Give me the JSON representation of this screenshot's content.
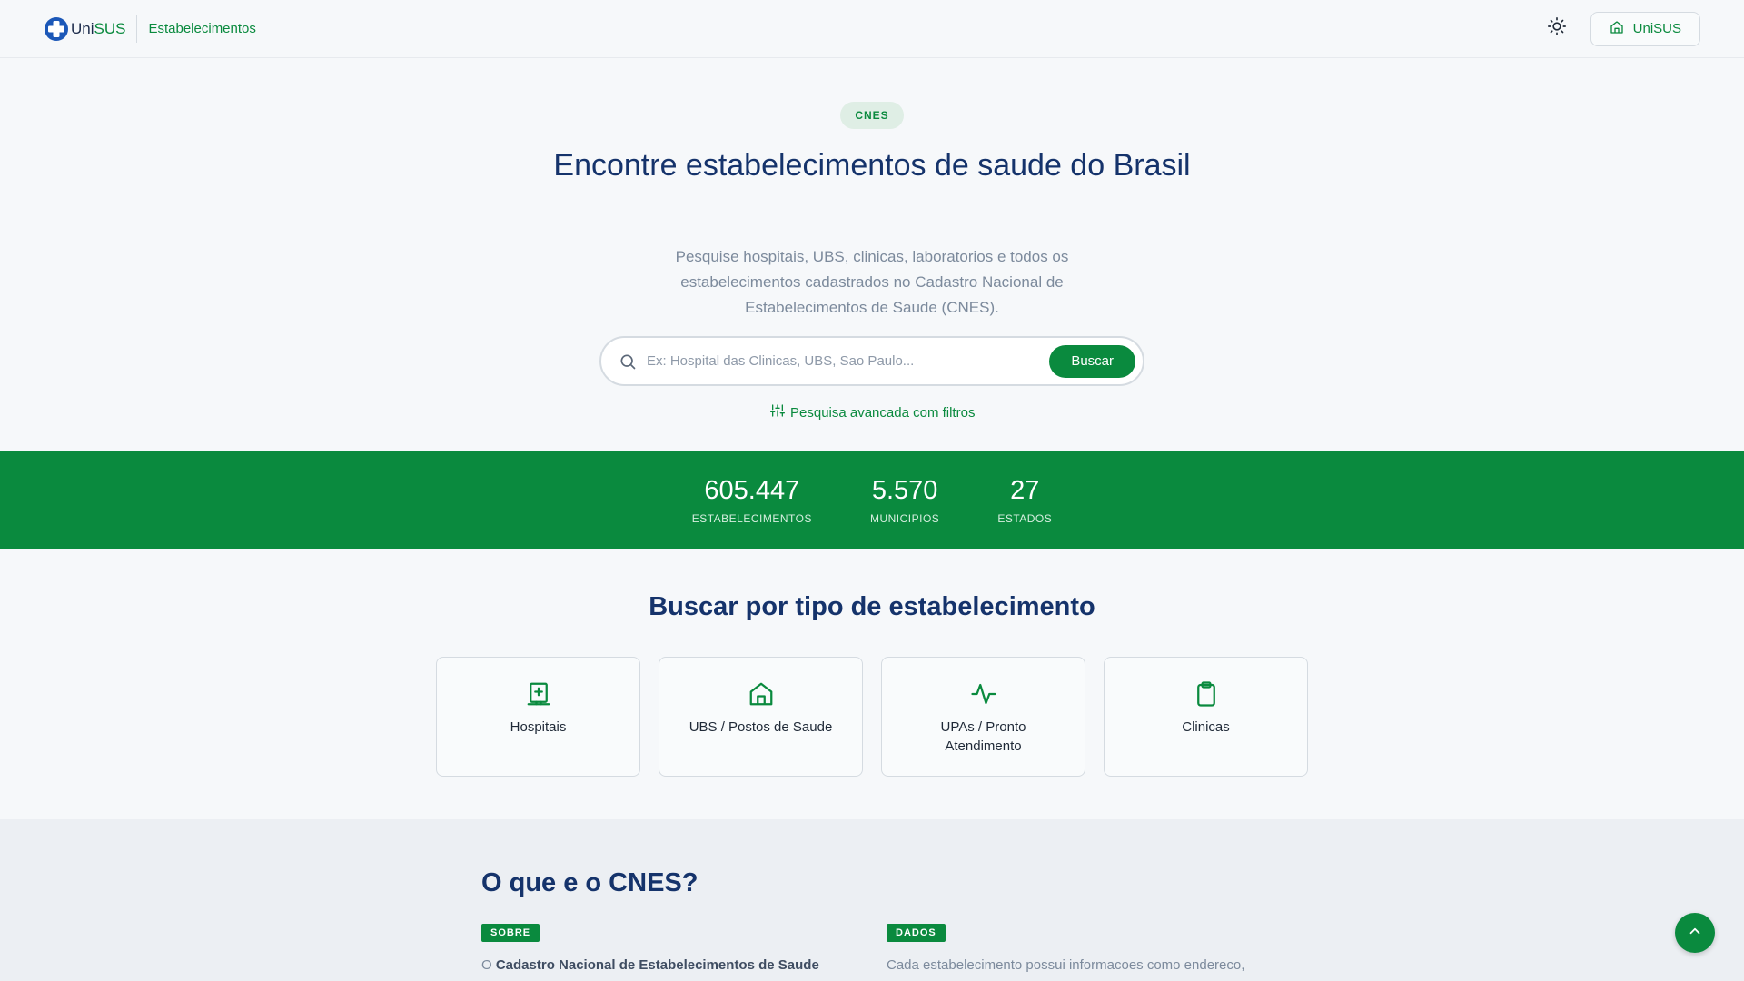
{
  "header": {
    "brand_uni": "Uni",
    "brand_sus": "SUS",
    "subtitle": "Estabelecimentos",
    "theme_icon": "sun-icon",
    "unisus_button_label": "UniSUS",
    "unisus_button_icon": "home-icon"
  },
  "hero": {
    "badge": "CNES",
    "title": "Encontre estabelecimentos de saude do Brasil",
    "description": "Pesquise hospitais, UBS, clinicas, laboratorios e todos os estabelecimentos cadastrados no Cadastro Nacional de Estabelecimentos de Saude (CNES).",
    "search_placeholder": "Ex: Hospital das Clinicas, UBS, Sao Paulo...",
    "search_value": "",
    "search_button": "Buscar",
    "advanced_link": "Pesquisa avancada com filtros"
  },
  "stats": [
    {
      "value": "605.447",
      "label": "ESTABELECIMENTOS"
    },
    {
      "value": "5.570",
      "label": "MUNICIPIOS"
    },
    {
      "value": "27",
      "label": "ESTADOS"
    }
  ],
  "types": {
    "title": "Buscar por tipo de estabelecimento",
    "items": [
      {
        "label": "Hospitais",
        "icon": "hospital-icon"
      },
      {
        "label": "UBS / Postos de Saude",
        "icon": "home-icon"
      },
      {
        "label": "UPAs / Pronto Atendimento",
        "icon": "activity-icon"
      },
      {
        "label": "Clinicas",
        "icon": "clipboard-icon"
      }
    ]
  },
  "about": {
    "title": "O que e o CNES?",
    "col1_tag": "SOBRE",
    "col1_text_prefix": "O ",
    "col1_text_bold": "Cadastro Nacional de Estabelecimentos de Saude",
    "col2_tag": "DADOS",
    "col2_text": "Cada estabelecimento possui informacoes como endereco,"
  },
  "colors": {
    "primary": "#0a8a3e",
    "heading": "#15336b",
    "muted": "#7c8a9c"
  }
}
